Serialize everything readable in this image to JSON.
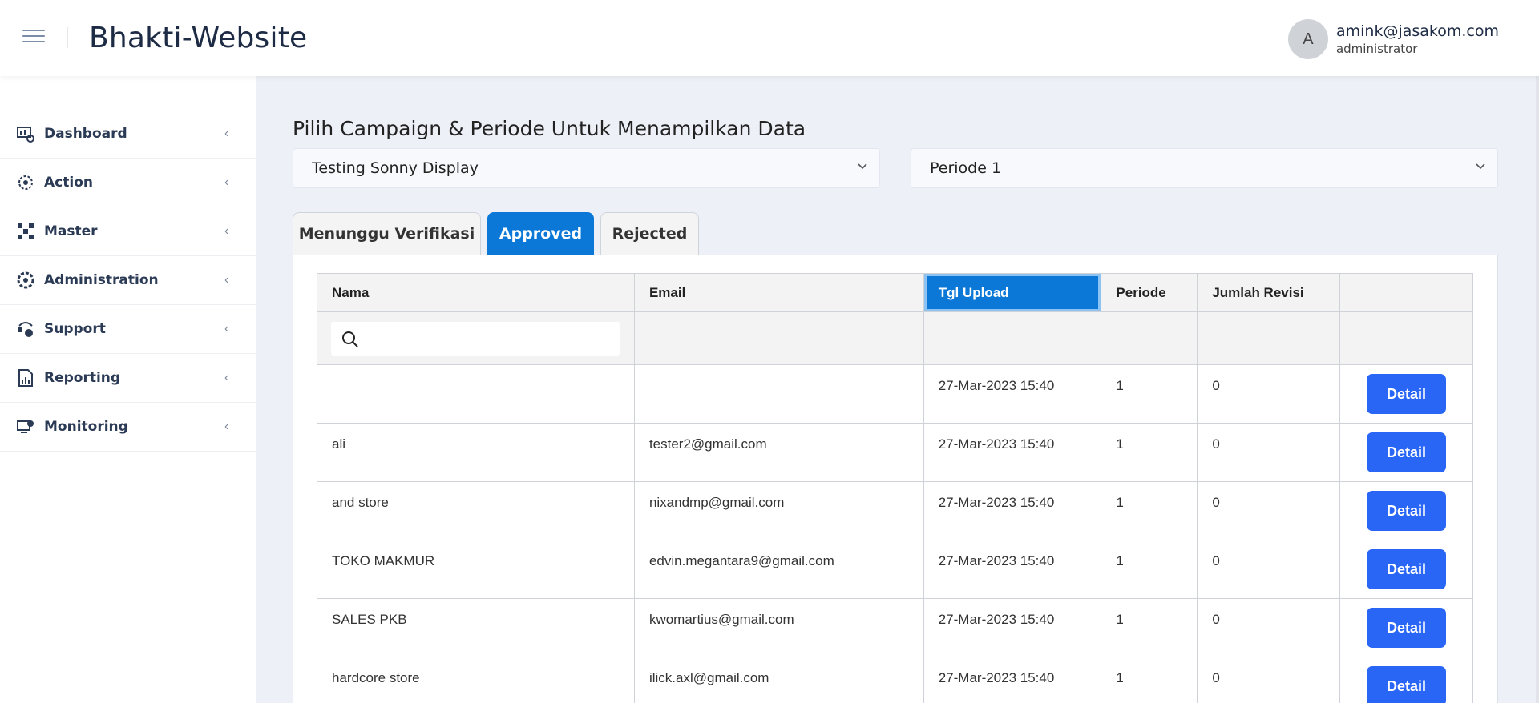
{
  "header": {
    "app_title": "Bhakti-Website",
    "user": {
      "avatar_initial": "A",
      "email": "amink@jasakom.com",
      "role": "administrator"
    }
  },
  "sidebar": {
    "items": [
      {
        "label": "Dashboard",
        "icon": "dashboard-icon"
      },
      {
        "label": "Action",
        "icon": "action-icon"
      },
      {
        "label": "Master",
        "icon": "master-icon"
      },
      {
        "label": "Administration",
        "icon": "administration-icon"
      },
      {
        "label": "Support",
        "icon": "support-icon"
      },
      {
        "label": "Reporting",
        "icon": "reporting-icon"
      },
      {
        "label": "Monitoring",
        "icon": "monitoring-icon"
      }
    ]
  },
  "main": {
    "title": "Pilih Campaign & Periode Untuk Menampilkan Data",
    "campaign_select": "Testing Sonny Display",
    "periode_select": "Periode 1",
    "tabs": [
      {
        "label": "Menunggu Verifikasi",
        "active": false
      },
      {
        "label": "Approved",
        "active": true
      },
      {
        "label": "Rejected",
        "active": false
      }
    ]
  },
  "table": {
    "headers": [
      "Nama",
      "Email",
      "Tgl Upload",
      "Periode",
      "Jumlah Revisi",
      ""
    ],
    "search_placeholder": "",
    "detail_label": "Detail",
    "rows": [
      {
        "nama": "",
        "email": "",
        "tgl": "27-Mar-2023 15:40",
        "periode": "1",
        "revisi": "0"
      },
      {
        "nama": "ali",
        "email": "tester2@gmail.com",
        "tgl": "27-Mar-2023 15:40",
        "periode": "1",
        "revisi": "0"
      },
      {
        "nama": "and store",
        "email": "nixandmp@gmail.com",
        "tgl": "27-Mar-2023 15:40",
        "periode": "1",
        "revisi": "0"
      },
      {
        "nama": "TOKO MAKMUR",
        "email": "edvin.megantara9@gmail.com",
        "tgl": "27-Mar-2023 15:40",
        "periode": "1",
        "revisi": "0"
      },
      {
        "nama": "SALES PKB",
        "email": "kwomartius@gmail.com",
        "tgl": "27-Mar-2023 15:40",
        "periode": "1",
        "revisi": "0"
      },
      {
        "nama": "hardcore store",
        "email": "ilick.axl@gmail.com",
        "tgl": "27-Mar-2023 15:40",
        "periode": "1",
        "revisi": "0"
      }
    ]
  },
  "colors": {
    "accent": "#0b78d8",
    "button": "#2a66f6",
    "background": "#edf0f7"
  }
}
